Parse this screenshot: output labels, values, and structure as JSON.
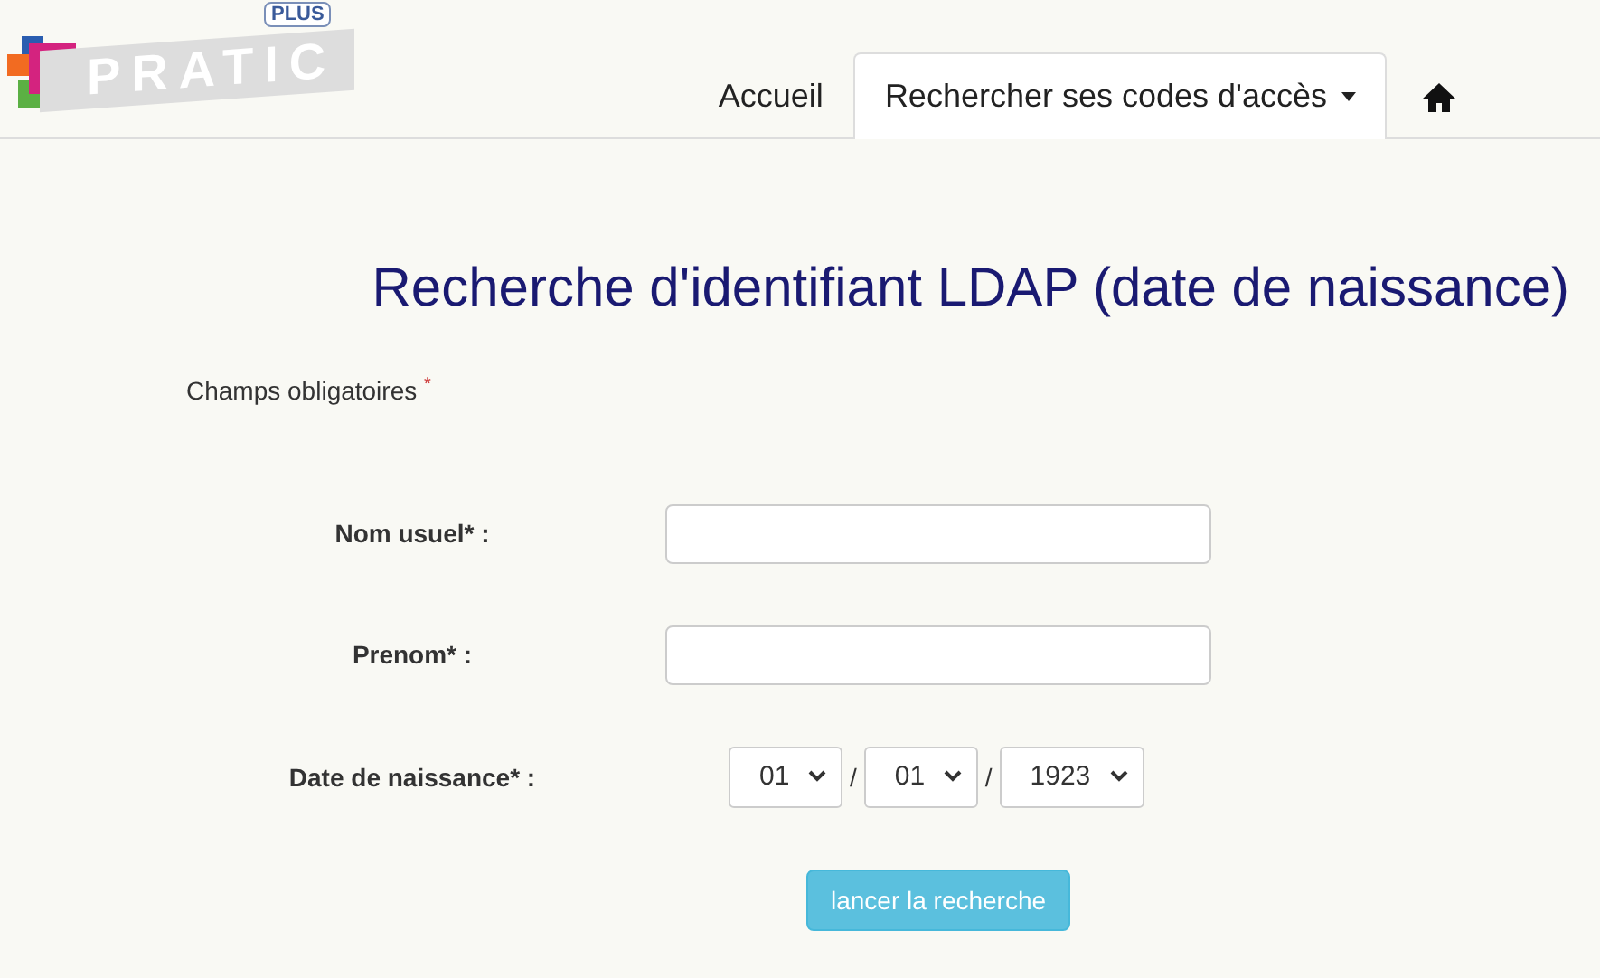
{
  "logo": {
    "text": "PRATIC",
    "badge": "PLUS"
  },
  "nav": [
    {
      "kind": "link",
      "label": "Accueil",
      "selected": false,
      "dropdown": false
    },
    {
      "kind": "link",
      "label": "Rechercher ses codes d'accès",
      "selected": true,
      "dropdown": true
    },
    {
      "kind": "home",
      "selected": false,
      "dropdown": false
    }
  ],
  "title": "Recherche d'identifiant LDAP (date de naissance)",
  "required_note": {
    "text": "Champs obligatoires",
    "mark": "*"
  },
  "fields": [
    {
      "kind": "text",
      "label": "Nom usuel* :"
    },
    {
      "kind": "text",
      "label": "Prenom* :"
    },
    {
      "kind": "date",
      "label": "Date de naissance* :",
      "parts": [
        "01",
        "01",
        "1923"
      ],
      "separators": [
        "/",
        "/"
      ]
    }
  ],
  "button": "lancer la recherche"
}
